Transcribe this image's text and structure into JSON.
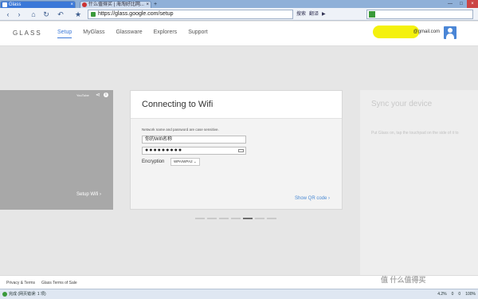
{
  "browser": {
    "tabs": [
      {
        "label": "Glass"
      },
      {
        "label": "什么值得买 | 海淘好比网..."
      }
    ],
    "new_tab": "+",
    "url": "https://glass.google.com/setup",
    "addr_tools": [
      "搜索",
      "翻译"
    ],
    "window_controls": [
      "—",
      "□",
      "×"
    ]
  },
  "header": {
    "logo": "GLASS",
    "nav": [
      {
        "label": "Setup",
        "active": true
      },
      {
        "label": "MyGlass"
      },
      {
        "label": "Glassware"
      },
      {
        "label": "Explorers"
      },
      {
        "label": "Support"
      }
    ],
    "email": "@gmail.com",
    "highlight_color": "#f4f10d"
  },
  "video": {
    "youtube_label": "YouTube",
    "setup_label": "Setup Wifi ›"
  },
  "card": {
    "title": "Connecting to Wifi",
    "hint": "Network name and password are case sensitive.",
    "ssid_value": "你的Wifi名称",
    "password_value": "●●●●●●●●●",
    "encryption_label": "Encryption",
    "encryption_value": "WPA/WPA2 ⌄",
    "qr_link": "Show QR code ›"
  },
  "next_card": {
    "title": "Sync your device",
    "text": "Put Glass on, tap the touchpad on the side of it to"
  },
  "progress": {
    "steps": 7,
    "current": 5
  },
  "footer": {
    "links": [
      "Privacy & Terms",
      "Glass Terms of Sale"
    ]
  },
  "statusbar": {
    "status": "完成 (网页错误: 1 项)",
    "zoom": "100%",
    "items": [
      "4.2%",
      "0",
      "0"
    ]
  },
  "watermark": "值 什么值得买",
  "colors": {
    "accent": "#3b78d8",
    "link": "#4a8ad4"
  }
}
